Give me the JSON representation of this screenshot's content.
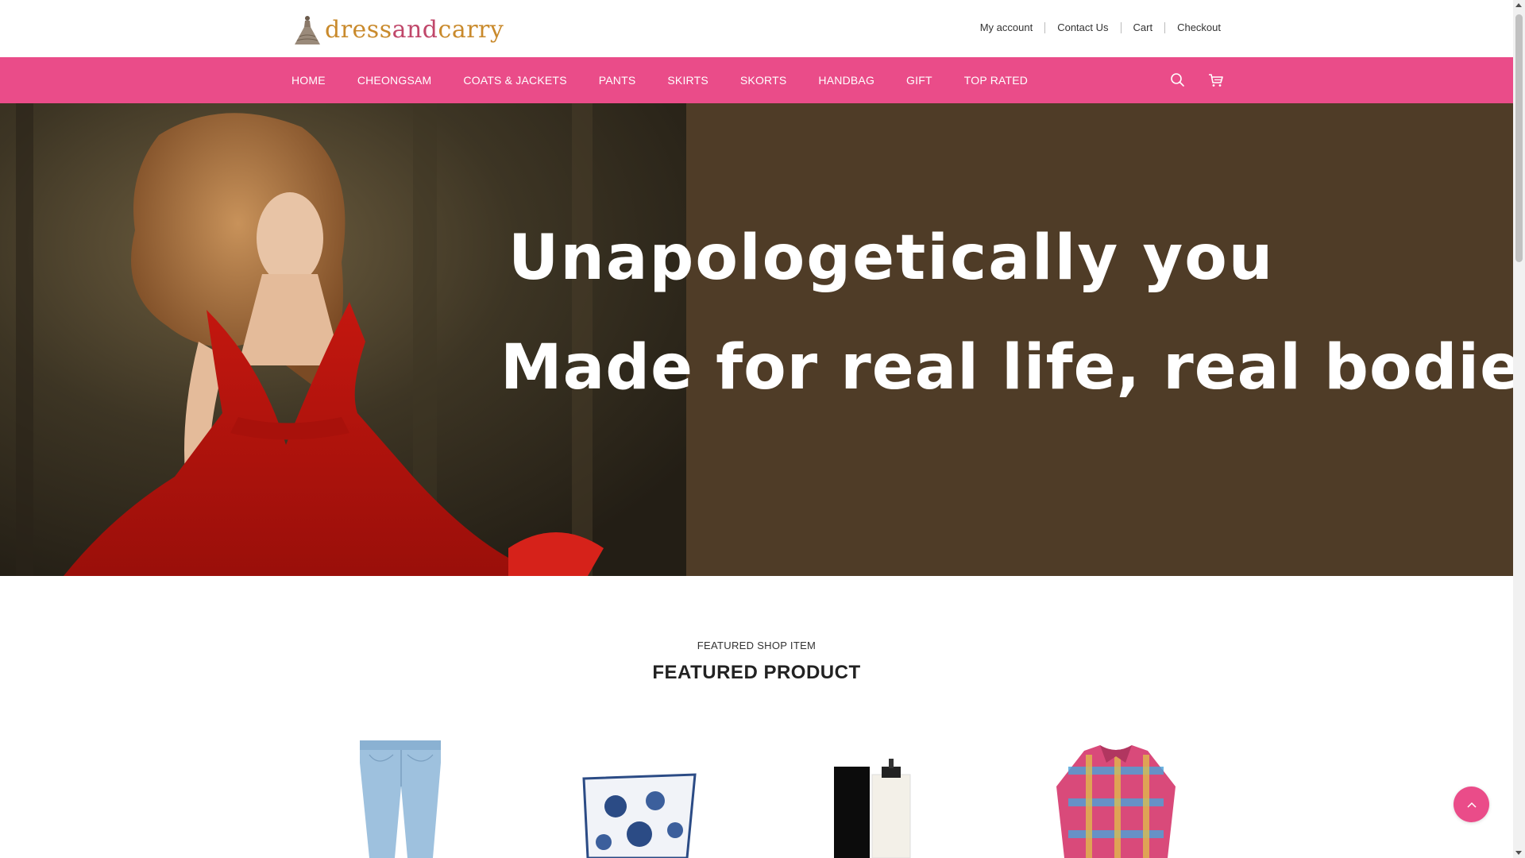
{
  "brand": {
    "logo_text_part1": "dress",
    "logo_text_part2": "and",
    "logo_text_part3": "carry",
    "accent_color": "#ea4c89"
  },
  "top_links": [
    "My account",
    "Contact Us",
    "Cart",
    "Checkout"
  ],
  "nav": {
    "items": [
      "HOME",
      "CHEONGSAM",
      "COATS & JACKETS",
      "PANTS",
      "SKIRTS",
      "SKORTS",
      "HANDBAG",
      "GIFT",
      "TOP RATED"
    ],
    "search_icon": "search-icon",
    "cart_icon": "cart-icon"
  },
  "hero": {
    "line1": "Unapologetically you",
    "line2": "Made for real life, real bodies"
  },
  "featured": {
    "subtitle": "FEATURED SHOP ITEM",
    "title": "FEATURED PRODUCT"
  },
  "back_to_top_icon": "chevron-up-icon"
}
